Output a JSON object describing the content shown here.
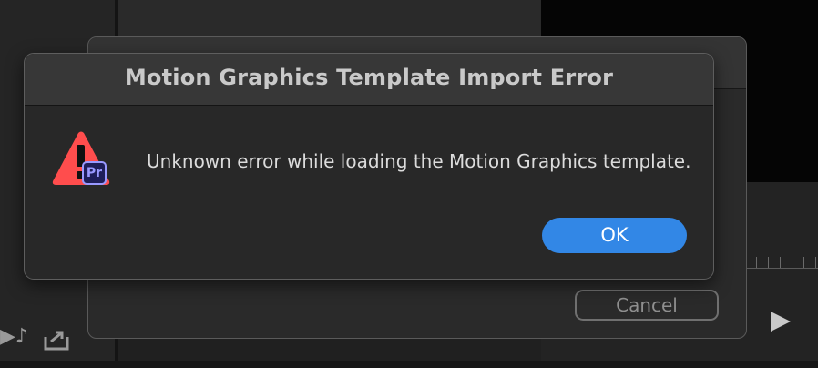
{
  "alert": {
    "title": "Motion Graphics Template Import Error",
    "message": "Unknown error while loading the Motion Graphics template.",
    "ok_label": "OK",
    "icon": "warning-triangle-icon",
    "badge_text": "Pr"
  },
  "back_dialog": {
    "cancel_label": "Cancel"
  },
  "background": {
    "audio_glyph": "▶♪"
  },
  "colors": {
    "accent": "#3287e6",
    "warning": "#ff4d4d",
    "premiere_badge_bg": "#1e1e59",
    "premiere_badge_fg": "#9999ff"
  }
}
